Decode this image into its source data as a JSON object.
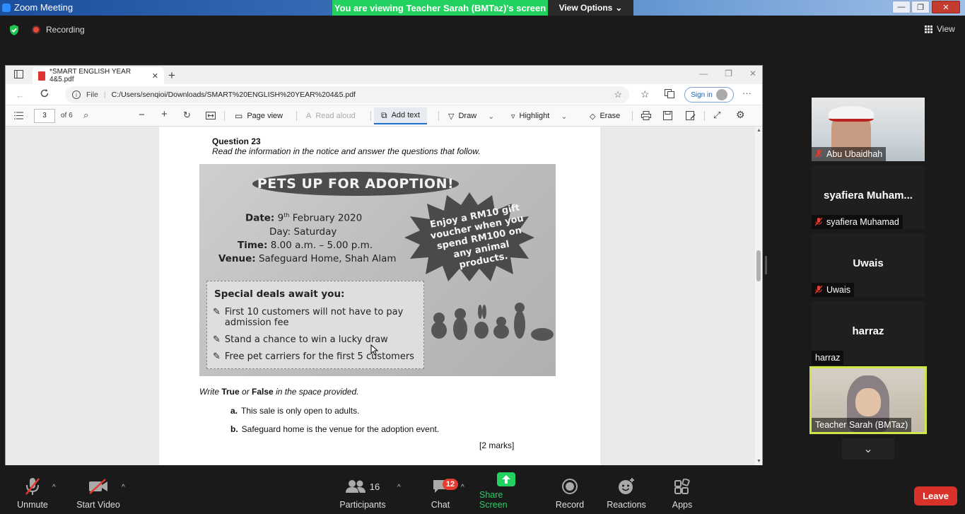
{
  "zoom": {
    "window_title": "Zoom Meeting",
    "viewing_banner": "You are viewing Teacher Sarah (BMTaz)'s screen",
    "view_options_label": "View Options",
    "recording_label": "Recording",
    "view_label": "View"
  },
  "edge": {
    "tab_title": "*SMART ENGLISH YEAR 4&5.pdf",
    "address_prefix": "File",
    "address_url": "C:/Users/senqioi/Downloads/SMART%20ENGLISH%20YEAR%204&5.pdf",
    "signin_label": "Sign in",
    "pdf_toolbar": {
      "page_number": "3",
      "page_total": "of 6",
      "page_view_label": "Page view",
      "read_aloud_label": "Read aloud",
      "add_text_label": "Add text",
      "draw_label": "Draw",
      "highlight_label": "Highlight",
      "erase_label": "Erase"
    }
  },
  "document": {
    "question_title": "Question 23",
    "question_instruction": "Read the information in the notice and answer the questions that follow.",
    "poster": {
      "banner": "PETS UP FOR ADOPTION!",
      "date_label": "Date:",
      "date_day": "9",
      "date_sup": "th",
      "date_rest": "February 2020",
      "day_line": "Day: Saturday",
      "time_label": "Time:",
      "time_value": "8.00 a.m. – 5.00 p.m.",
      "venue_label": "Venue:",
      "venue_value": "Safeguard Home, Shah Alam",
      "gift_text": "Enjoy a RM10 gift voucher when you spend RM100 on any animal products.",
      "deals_title": "Special deals await you:",
      "deals": [
        "First 10 customers will not have to pay admission fee",
        "Stand a chance to win a lucky draw",
        "Free pet carriers for the first 5 customers"
      ]
    },
    "tf_pre": "Write",
    "tf_true": "True",
    "tf_or": "or",
    "tf_false": "False",
    "tf_post": "in the space provided.",
    "questions": [
      {
        "letter": "a.",
        "text": "This sale is only open to adults."
      },
      {
        "letter": "b.",
        "text": "Safeguard home is the venue for the adoption event."
      }
    ],
    "marks": "[2 marks]"
  },
  "participants": [
    {
      "tile_name": "",
      "label": "Abu Ubaidhah",
      "muted": true
    },
    {
      "tile_name": "syafiera  Muham...",
      "label": "syafiera Muhamad",
      "muted": true
    },
    {
      "tile_name": "Uwais",
      "label": "Uwais",
      "muted": true
    },
    {
      "tile_name": "harraz",
      "label": "harraz",
      "muted": false
    },
    {
      "tile_name": "",
      "label": "Teacher Sarah (BMTaz)",
      "muted": false
    }
  ],
  "toolbar": {
    "unmute_label": "Unmute",
    "start_video_label": "Start Video",
    "participants_label": "Participants",
    "participants_count": "16",
    "chat_label": "Chat",
    "chat_badge": "12",
    "share_screen_label": "Share Screen",
    "record_label": "Record",
    "reactions_label": "Reactions",
    "apps_label": "Apps",
    "leave_label": "Leave"
  },
  "colors": {
    "banner_green": "#23d160",
    "share_green": "#23d160",
    "leave_red": "#d9322b",
    "active_speaker_border": "#cfe64a",
    "muted_red": "#e53b30"
  }
}
